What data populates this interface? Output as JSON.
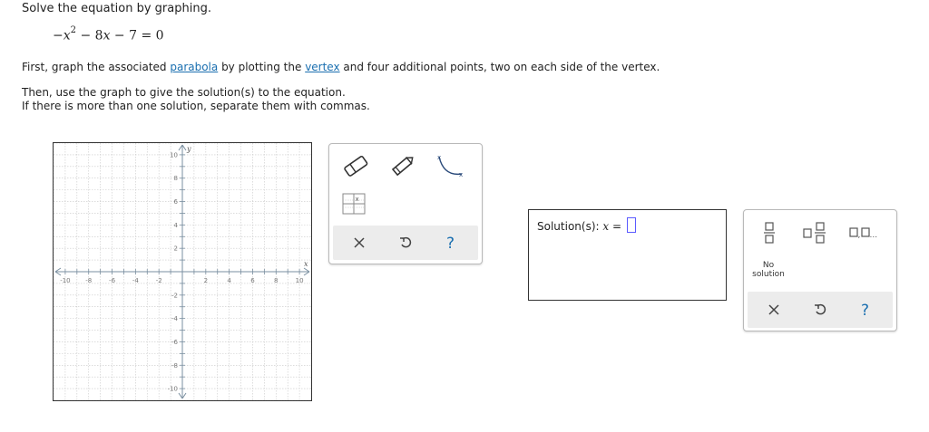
{
  "instruction": "Solve the equation by graphing.",
  "equation": {
    "lead": "−",
    "var": "x",
    "exponent": "2",
    "rest": " − 8",
    "var2": "x",
    "tail": " − 7 = 0"
  },
  "paragraph1": {
    "t1": "First, graph the associated ",
    "link1": "parabola",
    "t2": " by plotting the ",
    "link2": "vertex",
    "t3": " and four additional points, two on each side of the vertex."
  },
  "paragraph2": {
    "line_a": "Then, use the graph to give the solution(s) to the equation.",
    "line_b": "If there is more than one solution, separate them with commas."
  },
  "graph": {
    "x_axis_label": "x",
    "y_axis_label": "y",
    "x_range": [
      -10,
      10
    ],
    "y_range": [
      -10,
      10
    ],
    "x_tick_labels": [
      "-10",
      "-8",
      "-6",
      "-4",
      "-2",
      "2",
      "4",
      "6",
      "8",
      "10"
    ],
    "y_tick_labels": [
      "10",
      "8",
      "6",
      "4",
      "2",
      "-2",
      "-4",
      "-6",
      "-8",
      "-10"
    ],
    "grid": true
  },
  "toolbox": {
    "tools": [
      "eraser-icon",
      "pencil-icon",
      "parabola-tool-icon",
      "graph-table-icon"
    ],
    "footer": [
      "clear-x-icon",
      "undo-icon",
      "help-question-icon"
    ]
  },
  "answer": {
    "label": "Solution(s): ",
    "var": "x",
    "equals": " = ",
    "value": ""
  },
  "mathpad": {
    "buttons": [
      "fraction-icon",
      "mixed-number-icon",
      "list-comma-icon"
    ],
    "no_solution_line1": "No",
    "no_solution_line2": "solution",
    "list_dots": "..."
  },
  "colors": {
    "link": "#1a6fb0",
    "input_border": "#5a5aff",
    "footer_bg": "#ececec",
    "grid": "#c8c8c8",
    "axis": "#7a8fa0"
  }
}
